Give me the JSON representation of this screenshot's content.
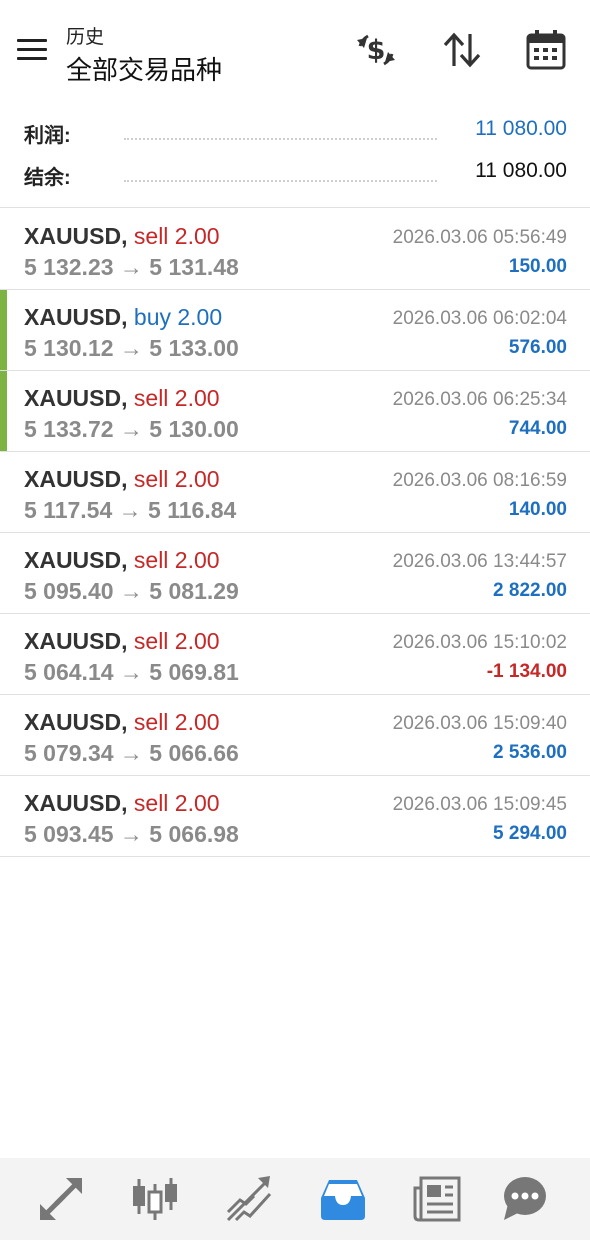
{
  "header": {
    "subtitle": "历史",
    "title": "全部交易品种"
  },
  "icons": {
    "menu": "menu-icon",
    "exchange": "currency-exchange-icon",
    "sort": "sort-icon",
    "calendar": "calendar-icon"
  },
  "summary": {
    "profit_label": "利润:",
    "profit_value": "11 080.00",
    "balance_label": "结余:",
    "balance_value": "11 080.00"
  },
  "colors": {
    "sell": "#c62828",
    "buy": "#1e6fc0",
    "positive": "#1e6fc0",
    "negative": "#c62828",
    "highlight_bar": "#7cb342",
    "active_nav": "#2f8ae0"
  },
  "deals": [
    {
      "symbol": "XAUUSD,",
      "side": "sell 2.00",
      "side_type": "sell",
      "prices": "5 132.23 → 5 131.48",
      "time": "2026.03.06 05:56:49",
      "profit": "150.00",
      "profit_type": "positive",
      "highlight": false
    },
    {
      "symbol": "XAUUSD,",
      "side": "buy 2.00",
      "side_type": "buy",
      "prices": "5 130.12 → 5 133.00",
      "time": "2026.03.06 06:02:04",
      "profit": "576.00",
      "profit_type": "positive",
      "highlight": true
    },
    {
      "symbol": "XAUUSD,",
      "side": "sell 2.00",
      "side_type": "sell",
      "prices": "5 133.72 → 5 130.00",
      "time": "2026.03.06 06:25:34",
      "profit": "744.00",
      "profit_type": "positive",
      "highlight": true
    },
    {
      "symbol": "XAUUSD,",
      "side": "sell 2.00",
      "side_type": "sell",
      "prices": "5 117.54 → 5 116.84",
      "time": "2026.03.06 08:16:59",
      "profit": "140.00",
      "profit_type": "positive",
      "highlight": false
    },
    {
      "symbol": "XAUUSD,",
      "side": "sell 2.00",
      "side_type": "sell",
      "prices": "5 095.40 → 5 081.29",
      "time": "2026.03.06 13:44:57",
      "profit": "2 822.00",
      "profit_type": "positive",
      "highlight": false
    },
    {
      "symbol": "XAUUSD,",
      "side": "sell 2.00",
      "side_type": "sell",
      "prices": "5 064.14 → 5 069.81",
      "time": "2026.03.06 15:10:02",
      "profit": "-1 134.00",
      "profit_type": "negative",
      "highlight": false
    },
    {
      "symbol": "XAUUSD,",
      "side": "sell 2.00",
      "side_type": "sell",
      "prices": "5 079.34 → 5 066.66",
      "time": "2026.03.06 15:09:40",
      "profit": "2 536.00",
      "profit_type": "positive",
      "highlight": false
    },
    {
      "symbol": "XAUUSD,",
      "side": "sell 2.00",
      "side_type": "sell",
      "prices": "5 093.45 → 5 066.98",
      "time": "2026.03.06 15:09:45",
      "profit": "5 294.00",
      "profit_type": "positive",
      "highlight": false
    }
  ],
  "bottom_nav": [
    {
      "icon": "quotes-icon",
      "active": false
    },
    {
      "icon": "chart-candles-icon",
      "active": false
    },
    {
      "icon": "trade-icon",
      "active": false
    },
    {
      "icon": "history-inbox-icon",
      "active": true
    },
    {
      "icon": "news-icon",
      "active": false
    },
    {
      "icon": "chat-icon",
      "active": false
    }
  ]
}
